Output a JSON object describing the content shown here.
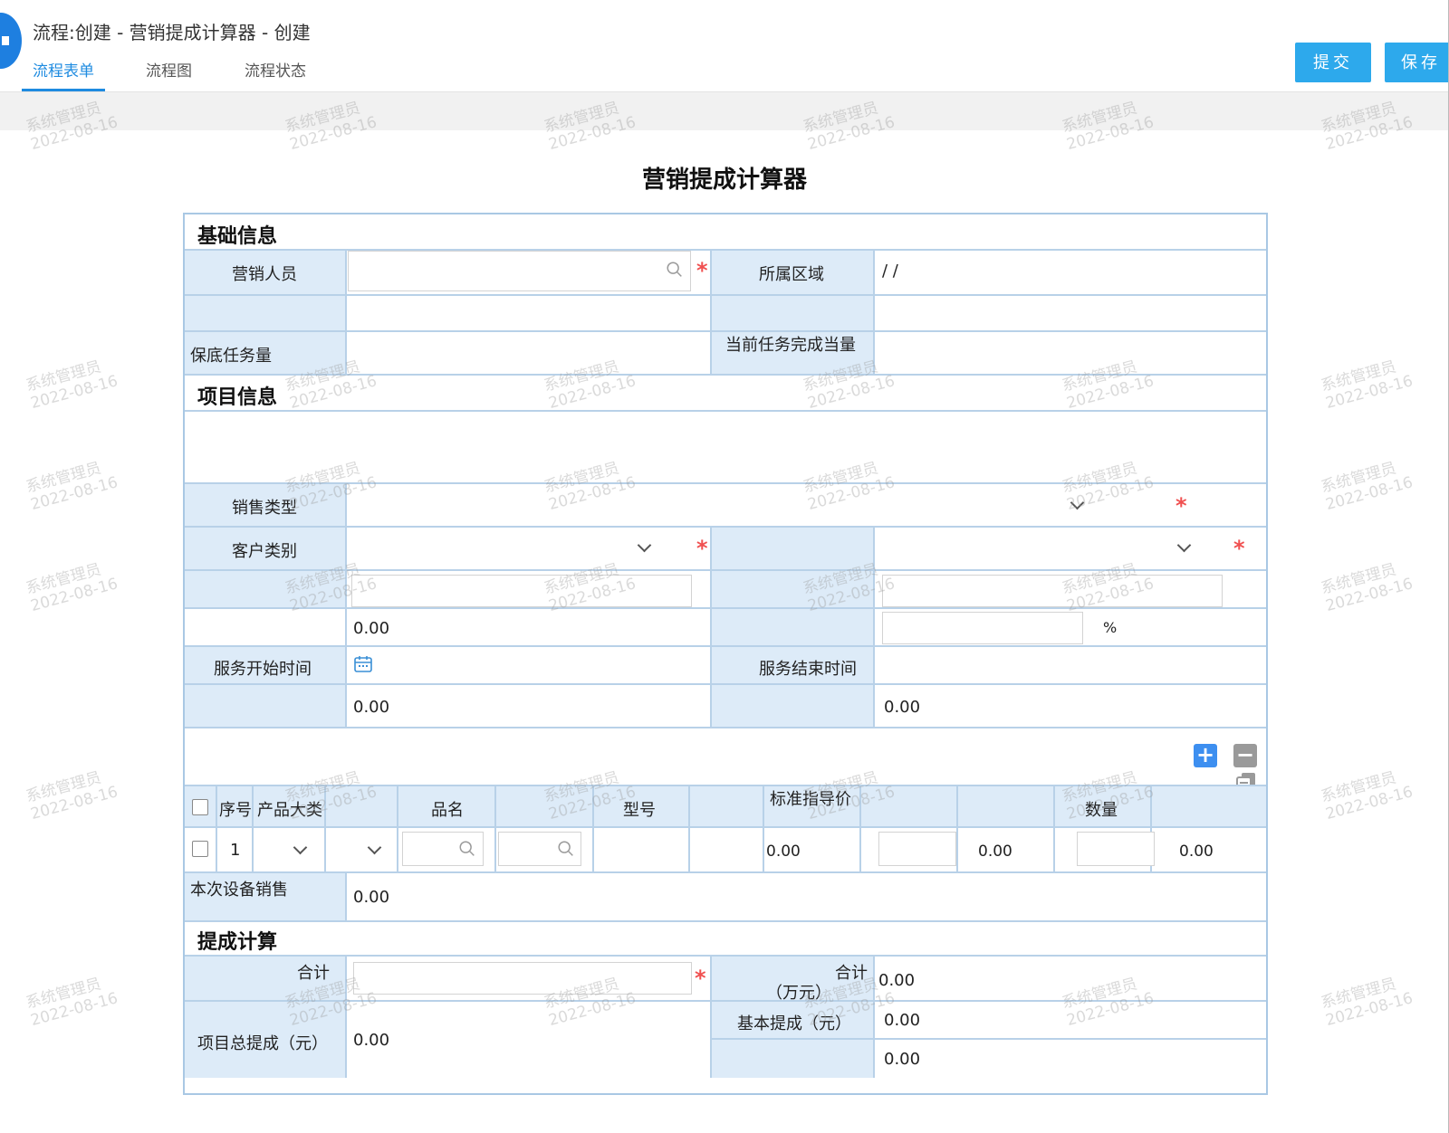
{
  "header": {
    "title": "流程:创建 - 营销提成计算器 - 创建",
    "tabs": [
      {
        "label": "流程表单",
        "active": true
      },
      {
        "label": "流程图"
      },
      {
        "label": "流程状态"
      }
    ],
    "submit_label": "提交",
    "save_label": "保存"
  },
  "watermark": {
    "user": "系统管理员",
    "date": "2022-08-16"
  },
  "form": {
    "title": "营销提成计算器",
    "sections": {
      "basic": "基础信息",
      "project": "项目信息",
      "commission": "提成计算"
    },
    "basic": {
      "salesperson_label": "营销人员",
      "region_label": "所属区域",
      "region_value": "/ /",
      "base_task_label": "保底任务量",
      "current_task_label": "当前任务完成当量"
    },
    "project": {
      "sales_type_label": "销售类型",
      "customer_type_label": "客户类别",
      "row4_value": "0.00",
      "percent_unit": "%",
      "service_start_label": "服务开始时间",
      "service_end_label": "服务结束时间",
      "row6_left_value": "0.00",
      "row6_right_value": "0.00"
    },
    "items_table": {
      "columns": [
        "序号",
        "产品大类",
        "品名",
        "型号",
        "标准指导价",
        "数量"
      ],
      "rows": [
        {
          "index": "1",
          "guide_price": "0.00",
          "amount1": "0.00",
          "amount2": "0.00"
        }
      ]
    },
    "equipment_sales_label": "本次设备销售",
    "equipment_sales_value": "0.00",
    "commission": {
      "total_label_fragment": "合计",
      "total2_label_fragment": "合计",
      "wan_unit_label": "（万元）",
      "total2_value": "0.00",
      "project_total_label": "项目总提成（元）",
      "project_total_value": "0.00",
      "base_commission_label": "基本提成（元）",
      "base_commission_value": "0.00",
      "extra_value": "0.00"
    }
  }
}
